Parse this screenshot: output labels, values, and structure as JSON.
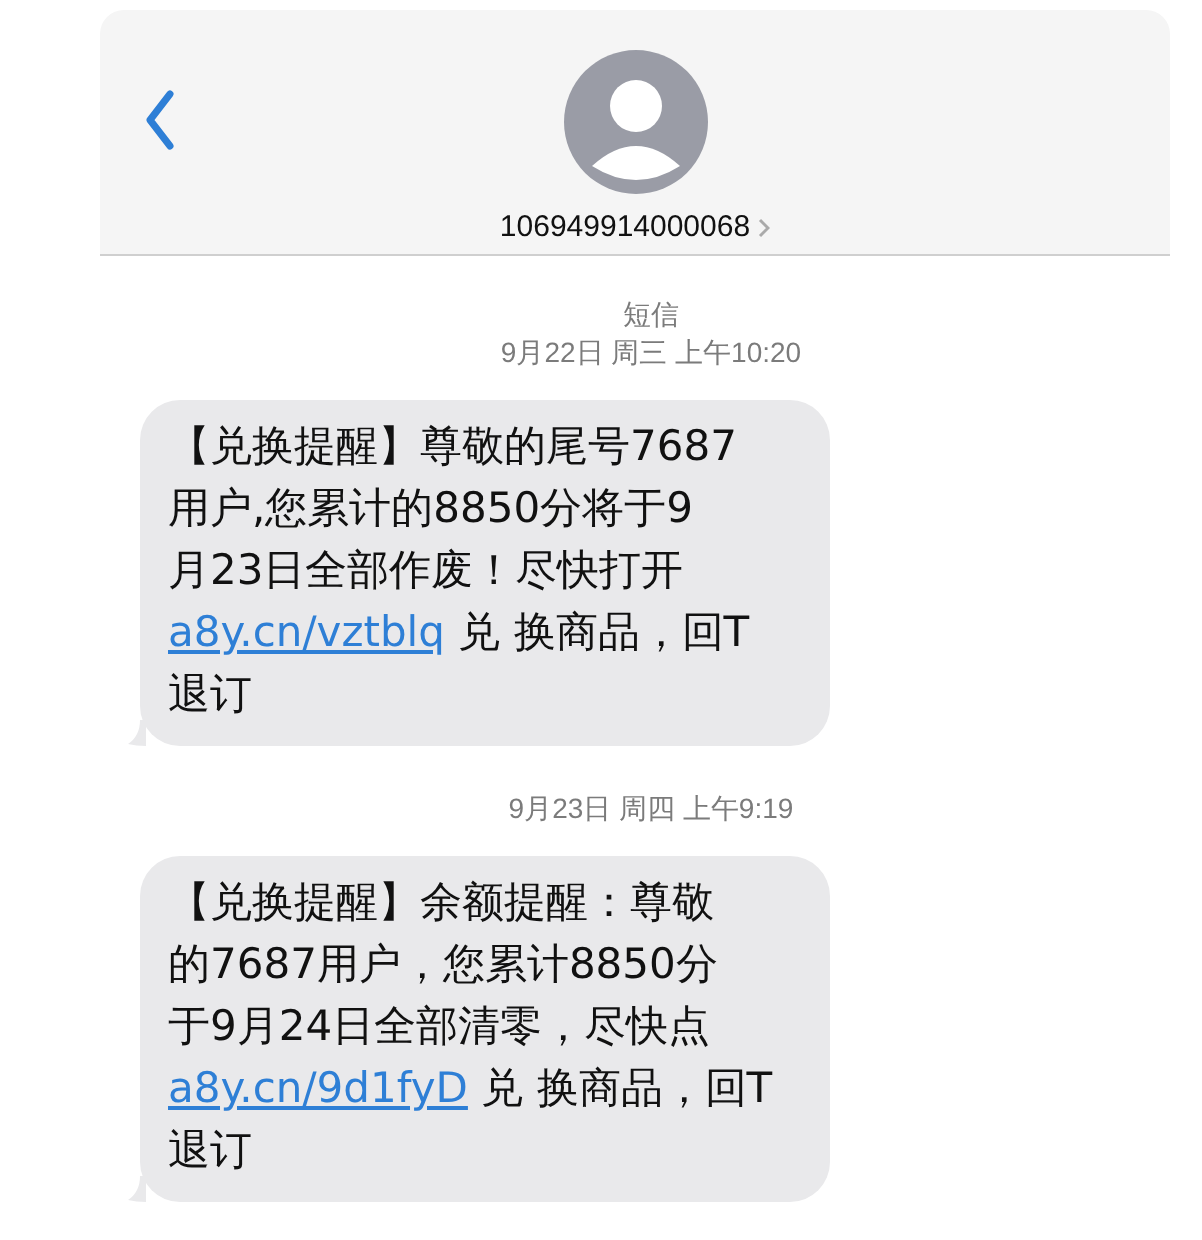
{
  "header": {
    "contact": "106949914000068"
  },
  "service_label": "短信",
  "messages": [
    {
      "timestamp": "9月22日 周三 上午10:20",
      "lines": [
        {
          "text": "【兑换提醒】尊敬的尾号7687"
        },
        {
          "text": "用户,您累计的8850分将于9"
        },
        {
          "text": "月23日全部作废！尽快打开"
        },
        {
          "link": "a8y.cn/vztblq",
          "text": " 兑 换商品，回T"
        },
        {
          "text": "退订"
        }
      ]
    },
    {
      "timestamp": "9月23日 周四 上午9:19",
      "lines": [
        {
          "text": "【兑换提醒】余额提醒：尊敬"
        },
        {
          "text": "的7687用户，您累计8850分"
        },
        {
          "text": "于9月24日全部清零，尽快点"
        },
        {
          "link": "a8y.cn/9d1fyD",
          "text": " 兑 换商品，回T"
        },
        {
          "text": "退订"
        }
      ]
    }
  ]
}
